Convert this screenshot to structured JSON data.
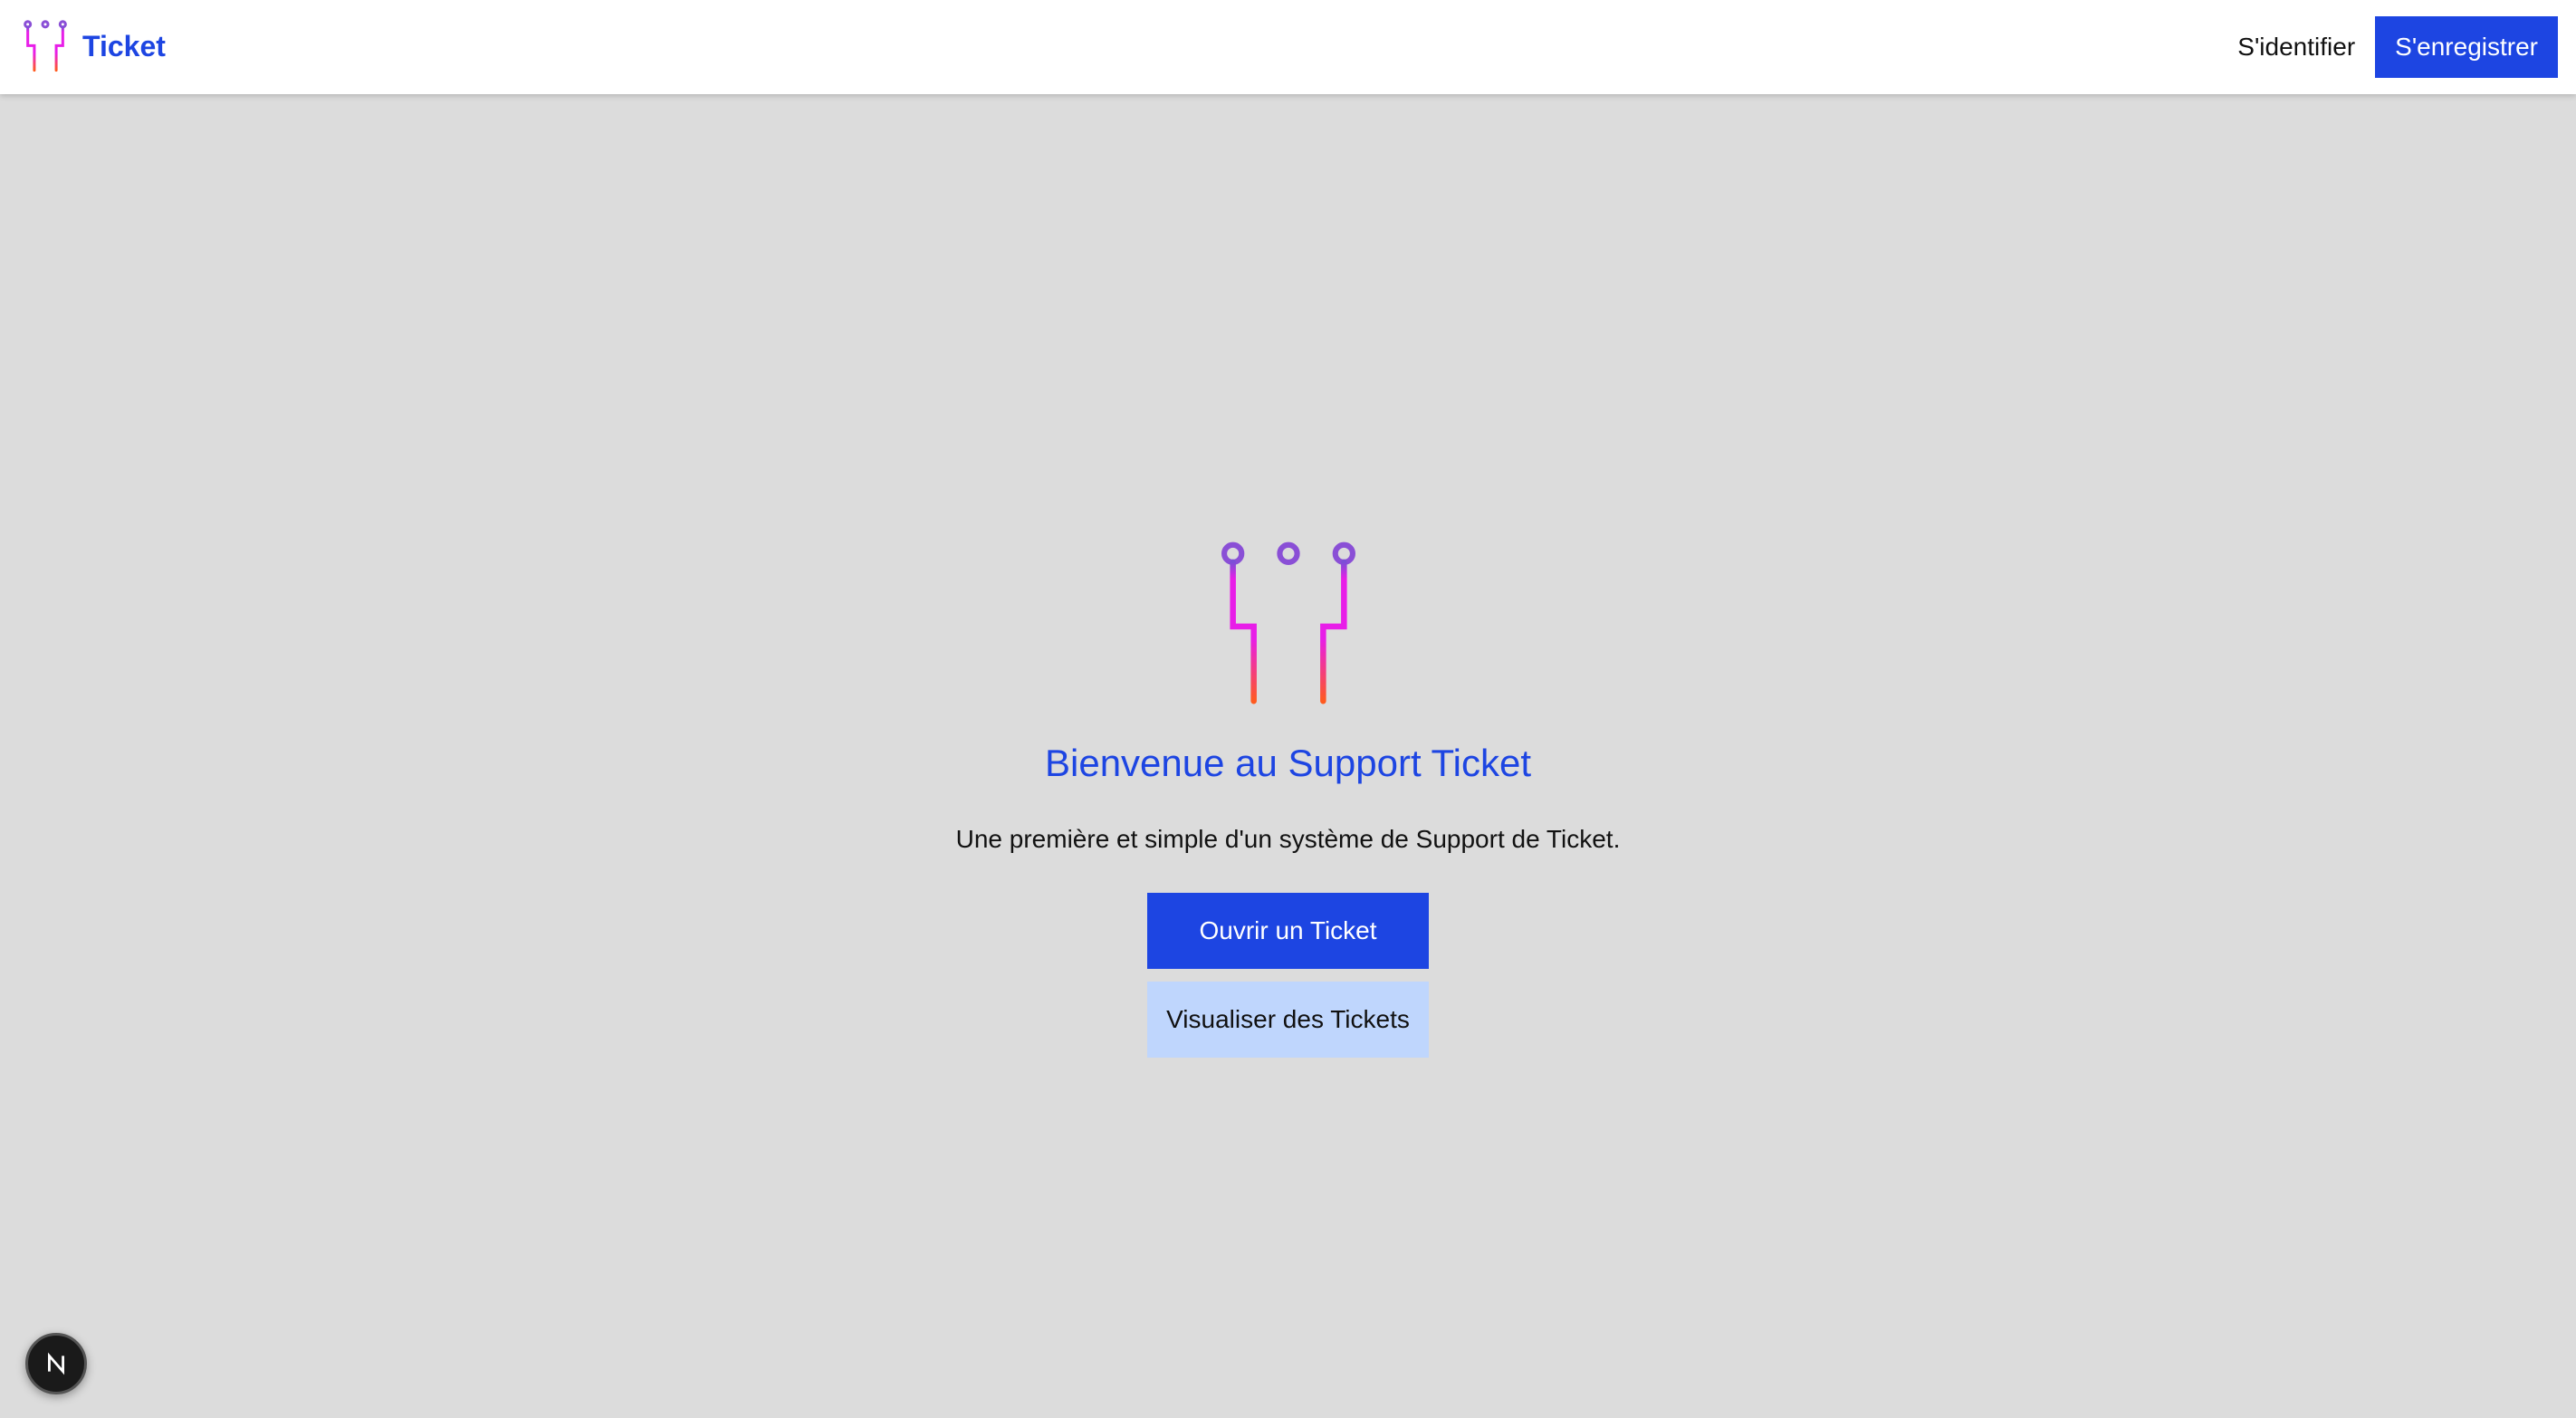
{
  "header": {
    "brand_name": "Ticket",
    "login_label": "S'identifier",
    "register_label": "S'enregistrer"
  },
  "hero": {
    "title": "Bienvenue au Support Ticket",
    "subtitle": "Une première et simple d'un système de Support de Ticket.",
    "open_ticket_label": "Ouvrir un Ticket",
    "view_tickets_label": "Visualiser des Tickets"
  },
  "icons": {
    "brand_logo": "circuit-logo-icon",
    "hero_logo": "circuit-logo-icon",
    "dev_indicator": "nextjs-icon"
  },
  "colors": {
    "accent": "#1d45e2",
    "background": "#dcdcdc",
    "secondary_button": "#bfd6fd",
    "logo_gradient_top": "#7b4fd6",
    "logo_gradient_mid": "#e81ee8",
    "logo_gradient_bottom": "#ff5a1f"
  }
}
